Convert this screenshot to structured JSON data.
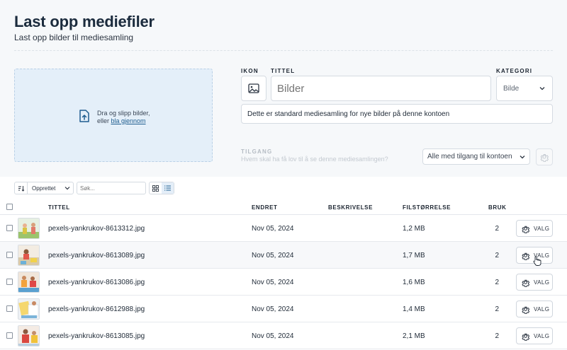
{
  "header": {
    "title": "Last opp mediefiler",
    "subtitle": "Last opp bilder til mediesamling"
  },
  "dropzone": {
    "line1": "Dra og slipp bilder,",
    "line2_prefix": "eller ",
    "browse_link": "bla gjennom"
  },
  "form": {
    "icon_label": "IKON",
    "title_label": "TITTEL",
    "title_placeholder": "Bilder",
    "category_label": "KATEGORI",
    "category_value": "Bilde",
    "description": "Dette er standard mediesamling for nye bilder på denne kontoen",
    "access_label": "TILGANG",
    "access_help": "Hvem skal ha få lov til å se denne mediesamlingen?",
    "access_value": "Alle med tilgang til kontoen"
  },
  "toolbar": {
    "sort_field": "Opprettet",
    "search_placeholder": "Søk..."
  },
  "table": {
    "columns": {
      "title": "TITTEL",
      "changed": "ENDRET",
      "description": "BESKRIVELSE",
      "size": "FILSTØRRELSE",
      "usage": "BRUK"
    },
    "option_label": "VALG",
    "rows": [
      {
        "title": "pexels-yankrukov-8613312.jpg",
        "changed": "Nov 05, 2024",
        "description": "",
        "size": "1,2 MB",
        "usage": "2"
      },
      {
        "title": "pexels-yankrukov-8613089.jpg",
        "changed": "Nov 05, 2024",
        "description": "",
        "size": "1,7 MB",
        "usage": "2"
      },
      {
        "title": "pexels-yankrukov-8613086.jpg",
        "changed": "Nov 05, 2024",
        "description": "",
        "size": "1,6 MB",
        "usage": "2"
      },
      {
        "title": "pexels-yankrukov-8612988.jpg",
        "changed": "Nov 05, 2024",
        "description": "",
        "size": "1,4 MB",
        "usage": "2"
      },
      {
        "title": "pexels-yankrukov-8613085.jpg",
        "changed": "Nov 05, 2024",
        "description": "",
        "size": "2,1 MB",
        "usage": "2"
      }
    ]
  },
  "icons": {
    "upload": "upload-file-icon",
    "image": "image-icon",
    "gear": "gear-icon",
    "sort": "sort-icon",
    "grid": "grid-view-icon",
    "list": "list-view-icon"
  },
  "colors": {
    "dropzone_bg": "#e4eff9",
    "link": "#1e5d8f",
    "active_toggle": "#e4eef8"
  }
}
